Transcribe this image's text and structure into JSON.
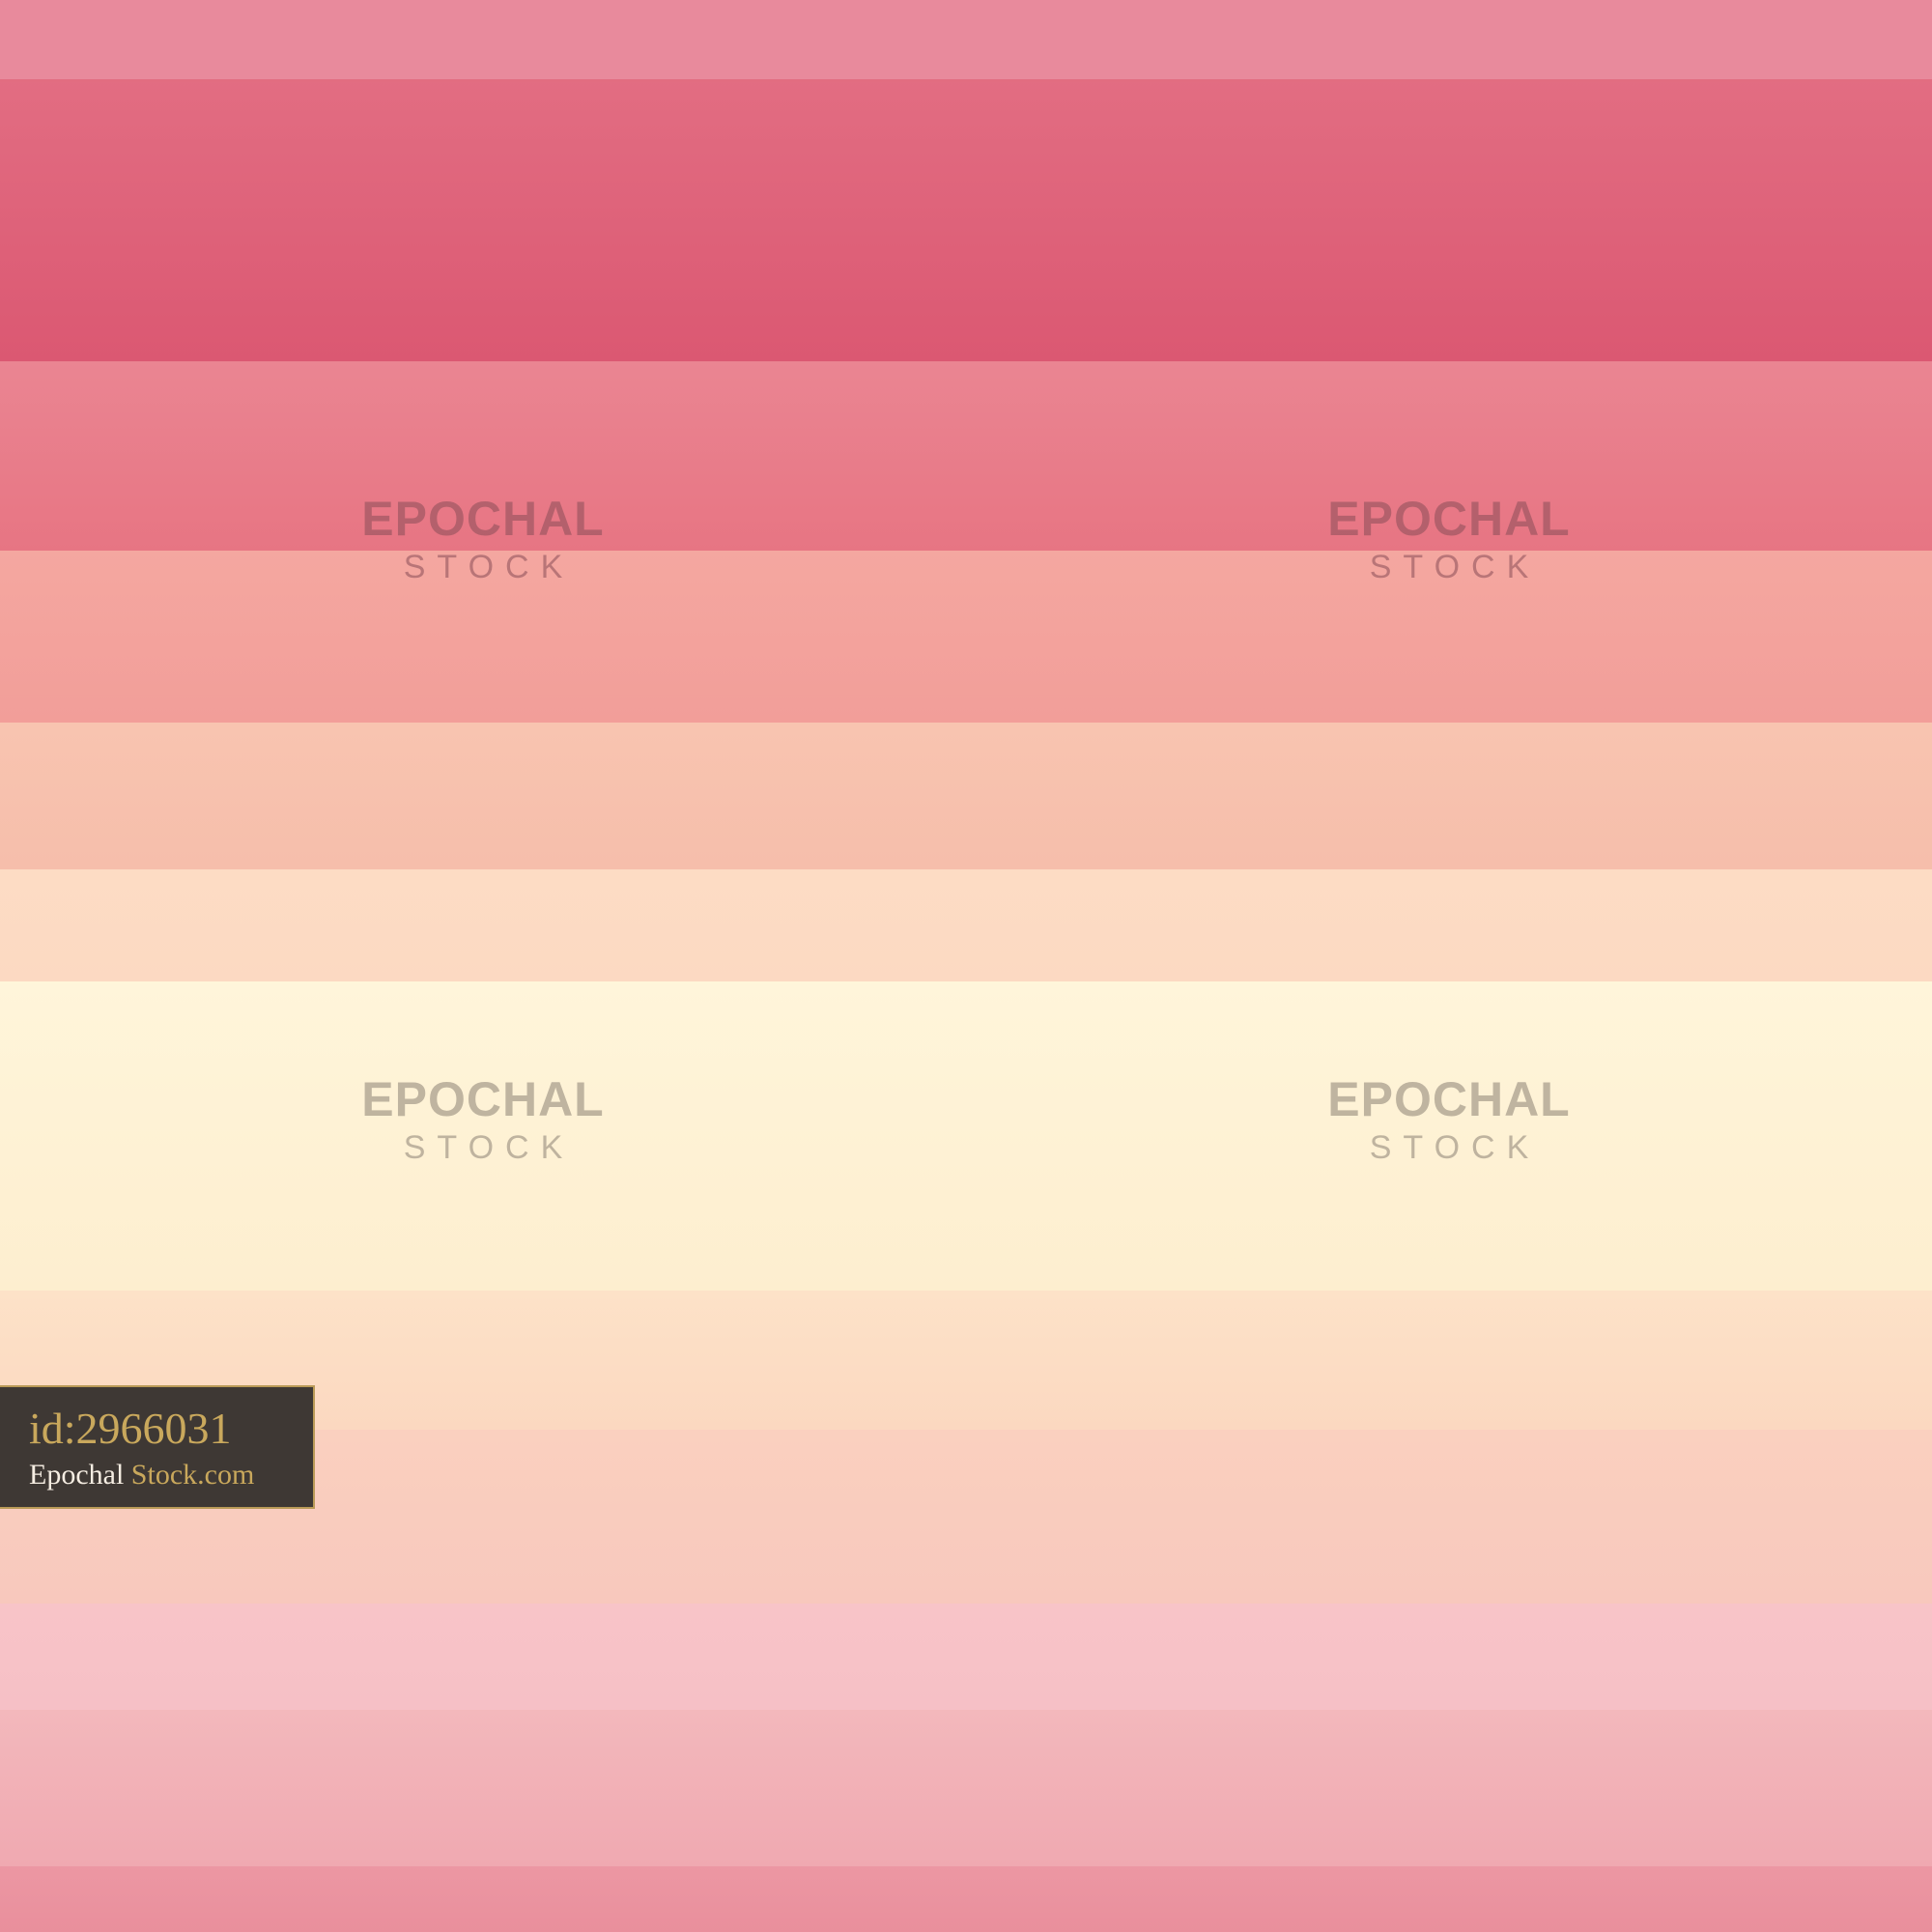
{
  "stripes": [
    {
      "id": "s1",
      "color_top": "#e88a9c",
      "color_bottom": "#e88a9c"
    },
    {
      "id": "s2",
      "color_top": "#e26d82",
      "color_bottom": "#db5872"
    },
    {
      "id": "s3",
      "color_top": "#ea8592",
      "color_bottom": "#e77583"
    },
    {
      "id": "s4",
      "color_top": "#f4a7a0",
      "color_bottom": "#f29e99"
    },
    {
      "id": "s5",
      "color_top": "#f8c4b0",
      "color_bottom": "#f6beab"
    },
    {
      "id": "s6",
      "color_top": "#fddcc4",
      "color_bottom": "#fcd9c2"
    },
    {
      "id": "s7",
      "color_top": "#fff5da",
      "color_bottom": "#fdeecf"
    },
    {
      "id": "s8",
      "color_top": "#fde2c8",
      "color_bottom": "#fbd8c0"
    },
    {
      "id": "s9",
      "color_top": "#fad0bf",
      "color_bottom": "#f8c8bd"
    },
    {
      "id": "s10",
      "color_top": "#f8c4c8",
      "color_bottom": "#f6c0c6"
    },
    {
      "id": "s11",
      "color_top": "#f3b8bc",
      "color_bottom": "#f0a9b1"
    },
    {
      "id": "s12",
      "color_top": "#ec97a3",
      "color_bottom": "#e98f9c"
    }
  ],
  "watermark": {
    "word": "EPOCHAL",
    "sub": "STOCK"
  },
  "badge": {
    "id_text": "id:2966031",
    "brand_first": "Epochal",
    "brand_second": "Stock.com",
    "background": "#3e3834",
    "accent": "#c9a85c"
  }
}
